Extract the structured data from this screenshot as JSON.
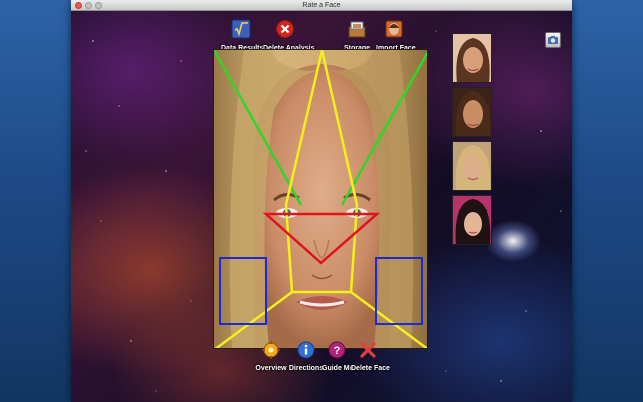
{
  "window": {
    "title": "Rate a Face"
  },
  "toolbar_top": [
    {
      "label": "Data Results",
      "icon": "square-root-icon"
    },
    {
      "label": "Delete Analysis",
      "icon": "red-x-circle-icon"
    },
    {
      "label": "Storage",
      "icon": "storage-box-icon"
    },
    {
      "label": "Import Face",
      "icon": "import-face-icon"
    }
  ],
  "toolbar_bottom": [
    {
      "label": "Overview",
      "icon": "gear-icon"
    },
    {
      "label": "Directions",
      "icon": "info-icon"
    },
    {
      "label": "Guide Me",
      "icon": "question-icon"
    },
    {
      "label": "Delete Face",
      "icon": "red-x-icon"
    }
  ],
  "overlay_colors": {
    "green": "#2fd62a",
    "yellow": "#f5ef1a",
    "red": "#e0141a",
    "blue": "#1a2bd6"
  },
  "thumbnails": [
    {
      "name": "face-thumbnail-1"
    },
    {
      "name": "face-thumbnail-2"
    },
    {
      "name": "face-thumbnail-3"
    },
    {
      "name": "face-thumbnail-4"
    }
  ],
  "camera_icon": "camera-icon"
}
